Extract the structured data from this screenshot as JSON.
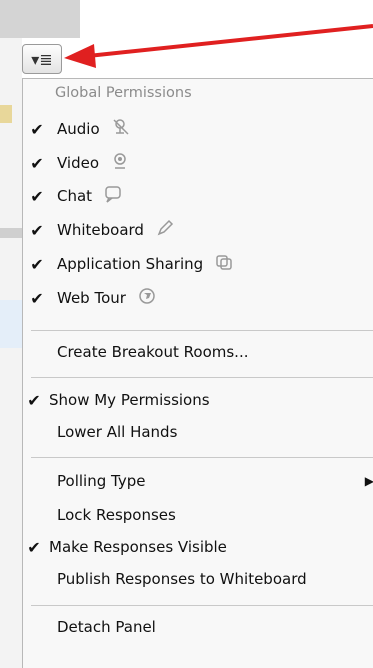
{
  "menu": {
    "section_title": "Global Permissions",
    "button_icon": "menu-lines-icon",
    "check_glyph": "✔",
    "permissions": [
      {
        "label": "Audio",
        "checked": true,
        "icon": "mute-icon"
      },
      {
        "label": "Video",
        "checked": true,
        "icon": "webcam-icon"
      },
      {
        "label": "Chat",
        "checked": true,
        "icon": "chat-bubble-icon"
      },
      {
        "label": "Whiteboard",
        "checked": true,
        "icon": "pencil-icon"
      },
      {
        "label": "Application Sharing",
        "checked": true,
        "icon": "windows-icon"
      },
      {
        "label": "Web Tour",
        "checked": true,
        "icon": "globe-icon"
      }
    ],
    "create_breakout": "Create Breakout Rooms...",
    "show_permissions": "Show My Permissions",
    "lower_hands": "Lower All Hands",
    "polling_type": "Polling Type",
    "lock_responses": "Lock Responses",
    "make_visible": "Make Responses Visible",
    "publish_responses": "Publish Responses to Whiteboard",
    "detach_panel": "Detach Panel"
  },
  "annotation": {
    "arrow_color": "#e02020"
  }
}
